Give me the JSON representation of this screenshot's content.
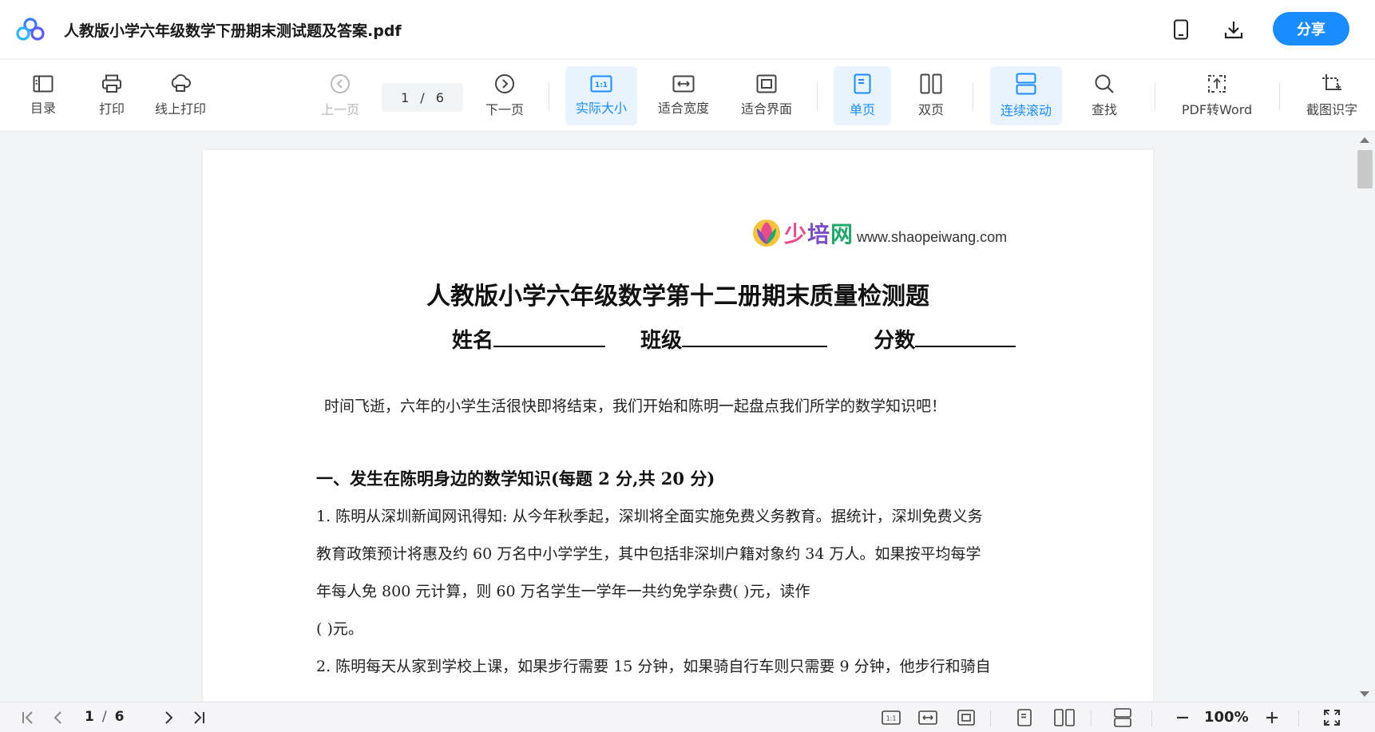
{
  "header": {
    "doc_title": "人教版小学六年级数学下册期末测试题及答案.pdf",
    "share_label": "分享",
    "icons": [
      "mobile-icon",
      "download-icon"
    ]
  },
  "toolbar": {
    "toc": "目录",
    "print": "打印",
    "online_print": "线上打印",
    "prev_page": "上一页",
    "current_page": "1",
    "page_sep": "/",
    "total_pages": "6",
    "next_page": "下一页",
    "actual_size": "实际大小",
    "fit_width": "适合宽度",
    "fit_screen": "适合界面",
    "single_page": "单页",
    "double_page": "双页",
    "continuous_scroll": "连续滚动",
    "find": "查找",
    "pdf_to_word": "PDF转Word",
    "screenshot_ocr": "截图识字",
    "accent_color": "#1a8cff"
  },
  "document": {
    "brand_name_1": "少",
    "brand_name_2": "培",
    "brand_name_3": "网",
    "brand_url": "www.shaopeiwang.com",
    "title": "人教版小学六年级数学第十二册期末质量检测题",
    "field_name": "姓名",
    "field_class": "班级",
    "field_score": "分数",
    "intro": "时间飞逝，六年的小学生活很快即将结束，我们开始和陈明一起盘点我们所学的数学知识吧！",
    "section_1": "一、发生在陈明身边的数学知识(每题 2 分,共 20 分)",
    "q1_line1": "1. 陈明从深圳新闻网讯得知: 从今年秋季起，深圳将全面实施免费义务教育。据统计，深圳免费义务",
    "q1_line2": "教育政策预计将惠及约 60 万名中小学学生，其中包括非深圳户籍对象约 34 万人。如果按平均每学",
    "q1_line3": "年每人免 800 元计算，则 60 万名学生一学年一共约免学杂费(                    )元，读作",
    "q1_line4": "(                              )元。",
    "q2_line1": "2. 陈明每天从家到学校上课，如果步行需要 15 分钟，如果骑自行车则只需要 9 分钟，他步行和骑自"
  },
  "statusbar": {
    "current_page": "1",
    "page_sep": "/",
    "total_pages": "6",
    "zoom": "100%"
  }
}
